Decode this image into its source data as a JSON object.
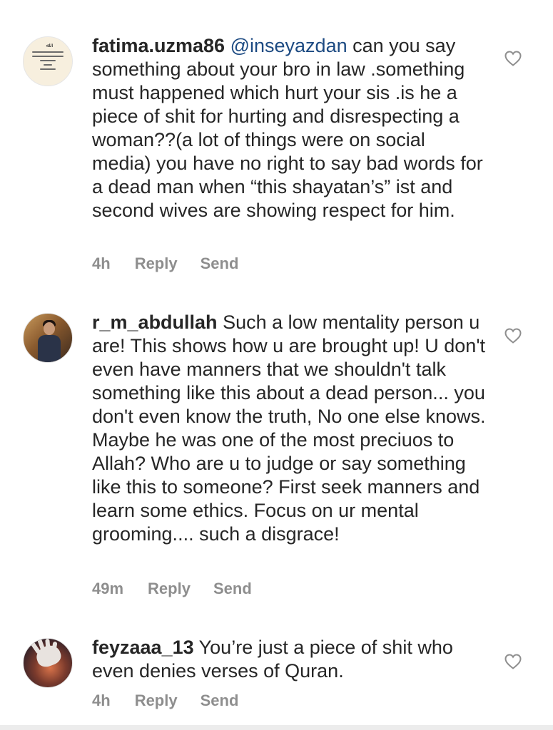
{
  "comments": [
    {
      "username": "fatima.uzma86",
      "mention": "@inseyazdan",
      "text": " can you say something about your bro in law .something must happened which hurt your sis .is he a piece of shit for hurting and disrespecting a woman??(a lot of things were on social media) you have no right to say bad words for a dead man when “this shayatan’s” ist and second wives are showing respect for him.",
      "time": "4h",
      "reply_label": "Reply",
      "send_label": "Send",
      "avatar_icon": "quote-card-avatar"
    },
    {
      "username": "r_m_abdullah",
      "mention": "",
      "text": " Such a low mentality person u are! This shows how u are brought up! U don't even have manners that we shouldn't talk something like this about a dead person... you don't even know the truth, No one else knows. Maybe he was one of the most preciuos to Allah? Who are u to judge or say something like this to someone? First seek manners and learn some ethics. Focus on ur mental grooming.... such a disgrace!",
      "time": "49m",
      "reply_label": "Reply",
      "send_label": "Send",
      "avatar_icon": "person-photo-avatar"
    },
    {
      "username": "feyzaaa_13",
      "mention": "",
      "text": " You’re just a piece of shit who even denies verses of Quran.",
      "time": "4h",
      "reply_label": "Reply",
      "send_label": "Send",
      "avatar_icon": "hand-photo-avatar"
    }
  ],
  "colors": {
    "text": "#262626",
    "meta": "#8e8e8e",
    "mention": "#1c4a82",
    "heart_stroke": "#8e8e8e"
  },
  "icons": {
    "like": "heart-outline-icon"
  }
}
